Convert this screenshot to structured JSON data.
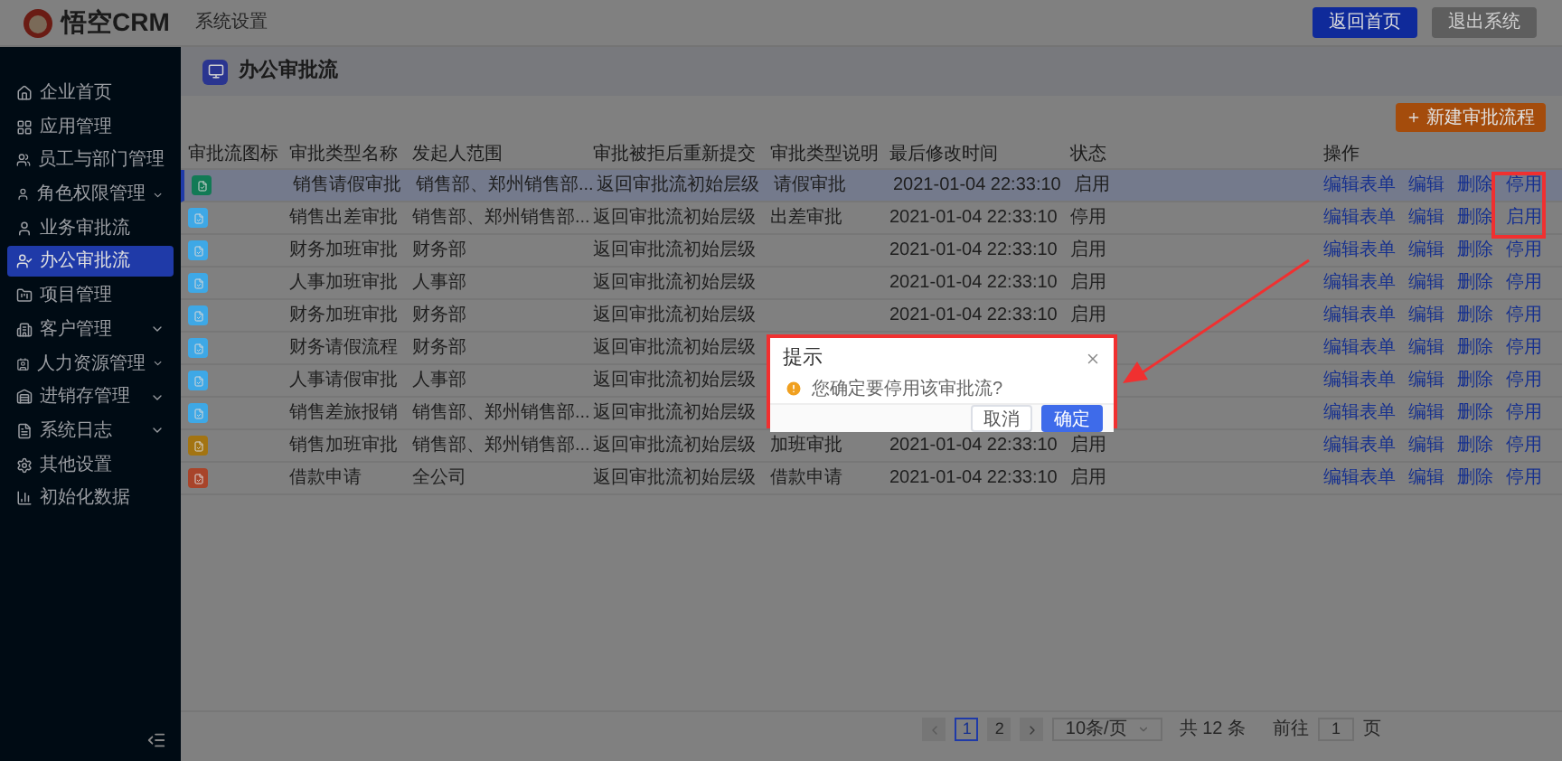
{
  "header": {
    "logo_text": "悟空CRM",
    "nav_item": "系统设置",
    "buttons": [
      {
        "label": "返回首页",
        "kind": "primary"
      },
      {
        "label": "退出系统",
        "kind": "default"
      }
    ]
  },
  "sidebar": {
    "items": [
      {
        "label": "企业首页",
        "selected": false,
        "expandable": false
      },
      {
        "label": "应用管理",
        "selected": false,
        "expandable": false
      },
      {
        "label": "员工与部门管理",
        "selected": false,
        "expandable": false
      },
      {
        "label": "角色权限管理",
        "selected": false,
        "expandable": true
      },
      {
        "label": "业务审批流",
        "selected": false,
        "expandable": false
      },
      {
        "label": "办公审批流",
        "selected": true,
        "expandable": false
      },
      {
        "label": "项目管理",
        "selected": false,
        "expandable": false
      },
      {
        "label": "客户管理",
        "selected": false,
        "expandable": true
      },
      {
        "label": "人力资源管理",
        "selected": false,
        "expandable": true
      },
      {
        "label": "进销存管理",
        "selected": false,
        "expandable": true
      },
      {
        "label": "系统日志",
        "selected": false,
        "expandable": true
      },
      {
        "label": "其他设置",
        "selected": false,
        "expandable": false
      },
      {
        "label": "初始化数据",
        "selected": false,
        "expandable": false
      }
    ]
  },
  "page_title": "办公审批流",
  "create_button": "新建审批流程",
  "table": {
    "columns": [
      "审批流图标",
      "审批类型名称",
      "发起人范围",
      "审批被拒后重新提交",
      "审批类型说明",
      "最后修改时间",
      "状态",
      "操作"
    ],
    "rows": [
      {
        "color": "#127a55",
        "name": "销售请假审批",
        "scope": "销售部、郑州销售部...",
        "reject": "返回审批流初始层级",
        "desc": "请假审批",
        "time": "2021-01-04 22:33:10",
        "status": "启用",
        "selected": true,
        "actions": [
          "编辑表单",
          "编辑",
          "删除",
          "停用"
        ]
      },
      {
        "color": "#3ea8e6",
        "name": "销售出差审批",
        "scope": "销售部、郑州销售部...",
        "reject": "返回审批流初始层级",
        "desc": "出差审批",
        "time": "2021-01-04 22:33:10",
        "status": "停用",
        "selected": false,
        "actions": [
          "编辑表单",
          "编辑",
          "删除",
          "启用"
        ]
      },
      {
        "color": "#3ea8e6",
        "name": "财务加班审批",
        "scope": "财务部",
        "reject": "返回审批流初始层级",
        "time": "2021-01-04 22:33:10",
        "status": "启用",
        "selected": false,
        "actions": [
          "编辑表单",
          "编辑",
          "删除",
          "停用"
        ]
      },
      {
        "color": "#3ea8e6",
        "name": "人事加班审批",
        "scope": "人事部",
        "reject": "返回审批流初始层级",
        "time": "2021-01-04 22:33:10",
        "status": "启用",
        "selected": false,
        "actions": [
          "编辑表单",
          "编辑",
          "删除",
          "停用"
        ]
      },
      {
        "color": "#3ea8e6",
        "name": "财务加班审批",
        "scope": "财务部",
        "reject": "返回审批流初始层级",
        "time": "2021-01-04 22:33:10",
        "status": "启用",
        "selected": false,
        "actions": [
          "编辑表单",
          "编辑",
          "删除",
          "停用"
        ]
      },
      {
        "color": "#3ea8e6",
        "name": "财务请假流程",
        "scope": "财务部",
        "reject": "返回审批流初始层级",
        "selected": false,
        "actions": [
          "编辑表单",
          "编辑",
          "删除",
          "停用"
        ]
      },
      {
        "color": "#3ea8e6",
        "name": "人事请假审批",
        "scope": "人事部",
        "reject": "返回审批流初始层级",
        "selected": false,
        "actions": [
          "编辑表单",
          "编辑",
          "删除",
          "停用"
        ]
      },
      {
        "color": "#3ea8e6",
        "name": "销售差旅报销",
        "scope": "销售部、郑州销售部...",
        "reject": "返回审批流初始层级",
        "selected": false,
        "actions": [
          "编辑表单",
          "编辑",
          "删除",
          "停用"
        ]
      },
      {
        "color": "#a37412",
        "name": "销售加班审批",
        "scope": "销售部、郑州销售部...",
        "reject": "返回审批流初始层级",
        "desc": "加班审批",
        "time": "2021-01-04 22:33:10",
        "status": "启用",
        "selected": false,
        "actions": [
          "编辑表单",
          "编辑",
          "删除",
          "停用"
        ]
      },
      {
        "color": "#a8442a",
        "name": "借款申请",
        "scope": "全公司",
        "reject": "返回审批流初始层级",
        "desc": "借款申请",
        "time": "2021-01-04 22:33:10",
        "status": "启用",
        "selected": false,
        "actions": [
          "编辑表单",
          "编辑",
          "删除",
          "停用"
        ]
      }
    ]
  },
  "pagination": {
    "pages": [
      {
        "label": "1",
        "selected": true
      },
      {
        "label": "2",
        "selected": false
      }
    ],
    "page_size": "10条/页",
    "total": "共 12 条",
    "goto_label": "前往",
    "goto_value": "1",
    "goto_suffix": "页"
  },
  "dialog": {
    "title": "提示",
    "message": "您确定要停用该审批流?",
    "buttons": [
      {
        "label": "取消",
        "kind": "default"
      },
      {
        "label": "确定",
        "kind": "primary"
      }
    ]
  }
}
